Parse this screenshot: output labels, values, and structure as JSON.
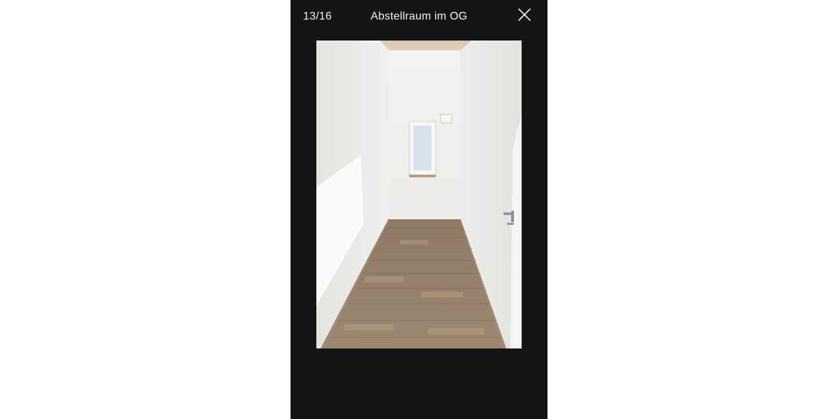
{
  "viewer": {
    "counter": "13/16",
    "title": "Abstellraum im OG",
    "close_icon": "close-icon"
  },
  "photo": {
    "subject": "room-photo"
  },
  "colors": {
    "viewer_background": "#141414",
    "page_background": "#ffffff",
    "text": "#f2f2f2"
  }
}
